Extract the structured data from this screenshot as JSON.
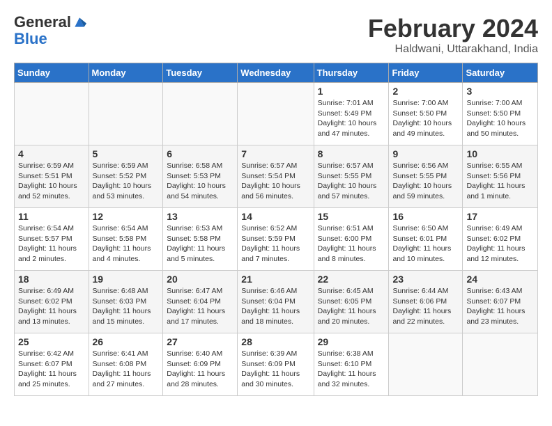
{
  "header": {
    "logo_line1": "General",
    "logo_line2": "Blue",
    "month": "February 2024",
    "location": "Haldwani, Uttarakhand, India"
  },
  "days_of_week": [
    "Sunday",
    "Monday",
    "Tuesday",
    "Wednesday",
    "Thursday",
    "Friday",
    "Saturday"
  ],
  "weeks": [
    [
      {
        "day": "",
        "sunrise": "",
        "sunset": "",
        "daylight": ""
      },
      {
        "day": "",
        "sunrise": "",
        "sunset": "",
        "daylight": ""
      },
      {
        "day": "",
        "sunrise": "",
        "sunset": "",
        "daylight": ""
      },
      {
        "day": "",
        "sunrise": "",
        "sunset": "",
        "daylight": ""
      },
      {
        "day": "1",
        "sunrise": "Sunrise: 7:01 AM",
        "sunset": "Sunset: 5:49 PM",
        "daylight": "Daylight: 10 hours and 47 minutes."
      },
      {
        "day": "2",
        "sunrise": "Sunrise: 7:00 AM",
        "sunset": "Sunset: 5:50 PM",
        "daylight": "Daylight: 10 hours and 49 minutes."
      },
      {
        "day": "3",
        "sunrise": "Sunrise: 7:00 AM",
        "sunset": "Sunset: 5:50 PM",
        "daylight": "Daylight: 10 hours and 50 minutes."
      }
    ],
    [
      {
        "day": "4",
        "sunrise": "Sunrise: 6:59 AM",
        "sunset": "Sunset: 5:51 PM",
        "daylight": "Daylight: 10 hours and 52 minutes."
      },
      {
        "day": "5",
        "sunrise": "Sunrise: 6:59 AM",
        "sunset": "Sunset: 5:52 PM",
        "daylight": "Daylight: 10 hours and 53 minutes."
      },
      {
        "day": "6",
        "sunrise": "Sunrise: 6:58 AM",
        "sunset": "Sunset: 5:53 PM",
        "daylight": "Daylight: 10 hours and 54 minutes."
      },
      {
        "day": "7",
        "sunrise": "Sunrise: 6:57 AM",
        "sunset": "Sunset: 5:54 PM",
        "daylight": "Daylight: 10 hours and 56 minutes."
      },
      {
        "day": "8",
        "sunrise": "Sunrise: 6:57 AM",
        "sunset": "Sunset: 5:55 PM",
        "daylight": "Daylight: 10 hours and 57 minutes."
      },
      {
        "day": "9",
        "sunrise": "Sunrise: 6:56 AM",
        "sunset": "Sunset: 5:55 PM",
        "daylight": "Daylight: 10 hours and 59 minutes."
      },
      {
        "day": "10",
        "sunrise": "Sunrise: 6:55 AM",
        "sunset": "Sunset: 5:56 PM",
        "daylight": "Daylight: 11 hours and 1 minute."
      }
    ],
    [
      {
        "day": "11",
        "sunrise": "Sunrise: 6:54 AM",
        "sunset": "Sunset: 5:57 PM",
        "daylight": "Daylight: 11 hours and 2 minutes."
      },
      {
        "day": "12",
        "sunrise": "Sunrise: 6:54 AM",
        "sunset": "Sunset: 5:58 PM",
        "daylight": "Daylight: 11 hours and 4 minutes."
      },
      {
        "day": "13",
        "sunrise": "Sunrise: 6:53 AM",
        "sunset": "Sunset: 5:58 PM",
        "daylight": "Daylight: 11 hours and 5 minutes."
      },
      {
        "day": "14",
        "sunrise": "Sunrise: 6:52 AM",
        "sunset": "Sunset: 5:59 PM",
        "daylight": "Daylight: 11 hours and 7 minutes."
      },
      {
        "day": "15",
        "sunrise": "Sunrise: 6:51 AM",
        "sunset": "Sunset: 6:00 PM",
        "daylight": "Daylight: 11 hours and 8 minutes."
      },
      {
        "day": "16",
        "sunrise": "Sunrise: 6:50 AM",
        "sunset": "Sunset: 6:01 PM",
        "daylight": "Daylight: 11 hours and 10 minutes."
      },
      {
        "day": "17",
        "sunrise": "Sunrise: 6:49 AM",
        "sunset": "Sunset: 6:02 PM",
        "daylight": "Daylight: 11 hours and 12 minutes."
      }
    ],
    [
      {
        "day": "18",
        "sunrise": "Sunrise: 6:49 AM",
        "sunset": "Sunset: 6:02 PM",
        "daylight": "Daylight: 11 hours and 13 minutes."
      },
      {
        "day": "19",
        "sunrise": "Sunrise: 6:48 AM",
        "sunset": "Sunset: 6:03 PM",
        "daylight": "Daylight: 11 hours and 15 minutes."
      },
      {
        "day": "20",
        "sunrise": "Sunrise: 6:47 AM",
        "sunset": "Sunset: 6:04 PM",
        "daylight": "Daylight: 11 hours and 17 minutes."
      },
      {
        "day": "21",
        "sunrise": "Sunrise: 6:46 AM",
        "sunset": "Sunset: 6:04 PM",
        "daylight": "Daylight: 11 hours and 18 minutes."
      },
      {
        "day": "22",
        "sunrise": "Sunrise: 6:45 AM",
        "sunset": "Sunset: 6:05 PM",
        "daylight": "Daylight: 11 hours and 20 minutes."
      },
      {
        "day": "23",
        "sunrise": "Sunrise: 6:44 AM",
        "sunset": "Sunset: 6:06 PM",
        "daylight": "Daylight: 11 hours and 22 minutes."
      },
      {
        "day": "24",
        "sunrise": "Sunrise: 6:43 AM",
        "sunset": "Sunset: 6:07 PM",
        "daylight": "Daylight: 11 hours and 23 minutes."
      }
    ],
    [
      {
        "day": "25",
        "sunrise": "Sunrise: 6:42 AM",
        "sunset": "Sunset: 6:07 PM",
        "daylight": "Daylight: 11 hours and 25 minutes."
      },
      {
        "day": "26",
        "sunrise": "Sunrise: 6:41 AM",
        "sunset": "Sunset: 6:08 PM",
        "daylight": "Daylight: 11 hours and 27 minutes."
      },
      {
        "day": "27",
        "sunrise": "Sunrise: 6:40 AM",
        "sunset": "Sunset: 6:09 PM",
        "daylight": "Daylight: 11 hours and 28 minutes."
      },
      {
        "day": "28",
        "sunrise": "Sunrise: 6:39 AM",
        "sunset": "Sunset: 6:09 PM",
        "daylight": "Daylight: 11 hours and 30 minutes."
      },
      {
        "day": "29",
        "sunrise": "Sunrise: 6:38 AM",
        "sunset": "Sunset: 6:10 PM",
        "daylight": "Daylight: 11 hours and 32 minutes."
      },
      {
        "day": "",
        "sunrise": "",
        "sunset": "",
        "daylight": ""
      },
      {
        "day": "",
        "sunrise": "",
        "sunset": "",
        "daylight": ""
      }
    ]
  ]
}
